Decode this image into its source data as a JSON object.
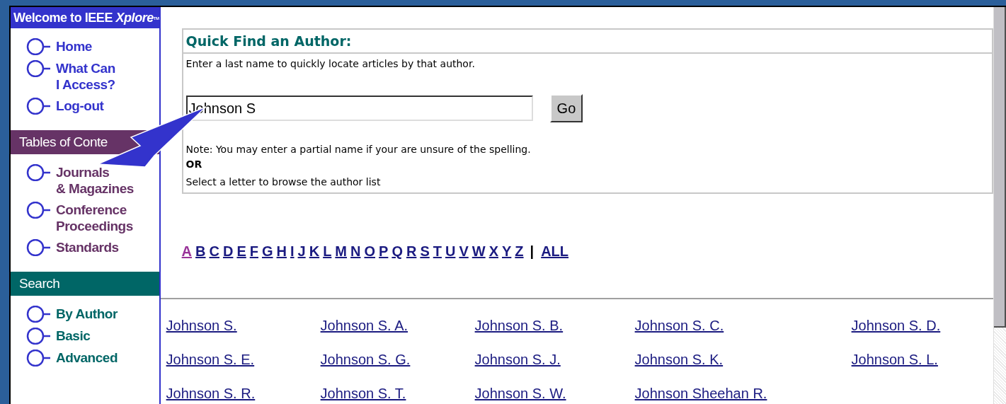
{
  "sidebar": {
    "title": "Welcome to IEEE Xplore",
    "title_mark": "TM",
    "sections": [
      {
        "kind": "plain",
        "items": [
          {
            "label": "Home"
          },
          {
            "label": "What Can\nI Access?"
          },
          {
            "label": "Log-out"
          }
        ]
      },
      {
        "kind": "contents",
        "heading": "Tables of Conte",
        "items": [
          {
            "label": "Journals\n& Magazines"
          },
          {
            "label": "Conference\nProceedings"
          },
          {
            "label": "Standards"
          }
        ]
      },
      {
        "kind": "search",
        "heading": "Search",
        "items": [
          {
            "label": "By Author"
          },
          {
            "label": "Basic"
          },
          {
            "label": "Advanced"
          }
        ]
      }
    ]
  },
  "quick_find": {
    "title": "Quick Find an Author:",
    "intro": "Enter a last name to quickly locate articles by that author.",
    "value": "Johnson S",
    "button": "Go",
    "note": "Note: You may enter a partial name if your are unsure of the spelling.",
    "or": "OR",
    "browse": "Select a letter to browse the author list"
  },
  "letters": [
    {
      "label": "A",
      "visited": true
    },
    {
      "label": "B",
      "visited": false
    },
    {
      "label": "C",
      "visited": false
    },
    {
      "label": "D",
      "visited": false
    },
    {
      "label": "E",
      "visited": false
    },
    {
      "label": "F",
      "visited": false
    },
    {
      "label": "G",
      "visited": false
    },
    {
      "label": "H",
      "visited": false
    },
    {
      "label": "I",
      "visited": false
    },
    {
      "label": "J",
      "visited": false
    },
    {
      "label": "K",
      "visited": false
    },
    {
      "label": "L",
      "visited": false
    },
    {
      "label": "M",
      "visited": false
    },
    {
      "label": "N",
      "visited": false
    },
    {
      "label": "O",
      "visited": false
    },
    {
      "label": "P",
      "visited": false
    },
    {
      "label": "Q",
      "visited": false
    },
    {
      "label": "R",
      "visited": false
    },
    {
      "label": "S",
      "visited": false
    },
    {
      "label": "T",
      "visited": false
    },
    {
      "label": "U",
      "visited": false
    },
    {
      "label": "V",
      "visited": false
    },
    {
      "label": "W",
      "visited": false
    },
    {
      "label": "X",
      "visited": false
    },
    {
      "label": "Y",
      "visited": false
    },
    {
      "label": "Z",
      "visited": false
    }
  ],
  "separator": "|",
  "all_link": "ALL",
  "authors": [
    [
      "Johnson S.",
      "Johnson S. A.",
      "Johnson S. B.",
      "Johnson S. C.",
      "Johnson S. D."
    ],
    [
      "Johnson S. E.",
      "Johnson S. G.",
      "Johnson S. J.",
      "Johnson S. K.",
      "Johnson S. L."
    ],
    [
      "Johnson S. R.",
      "Johnson S. T.",
      "Johnson S. W.",
      "Johnson Sheehan R."
    ]
  ]
}
